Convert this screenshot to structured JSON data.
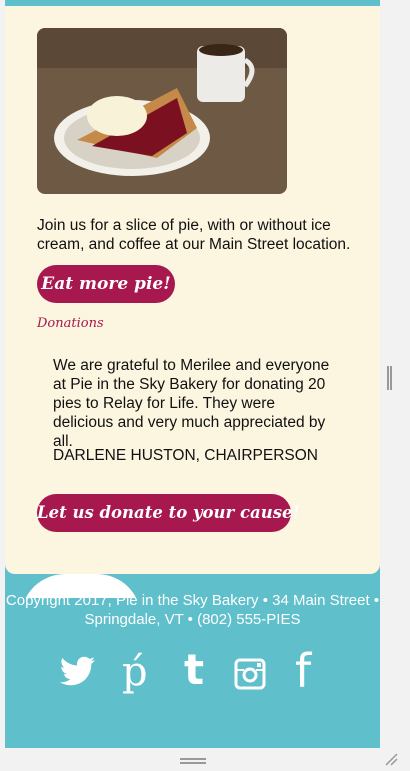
{
  "intro_text": "Join us for a slice of pie, with or without ice cream, and coffee at our Main Street location.",
  "eat_button": "Eat more pie!",
  "donations_heading": "Donations",
  "quote_text": "We are grateful to Merilee and everyone at Pie in the Sky Bakery for donating 20 pies to Relay for Life. They were delicious and very much appreciated by all.",
  "signature": "DARLENE HUSTON, CHAIRPERSON",
  "donate_button": "Let us donate to your cause!",
  "footer": "Copyright 2017, Pie in the Sky Bakery • 34 Main Street • Springdale, VT • (802) 555-PIES",
  "social_icons": [
    "twitter-icon",
    "pinterest-icon",
    "tumblr-icon",
    "instagram-icon",
    "facebook-icon"
  ],
  "colors": {
    "accent": "#a7184f",
    "card": "#fcf5df",
    "footer_bg": "#5fbfcb"
  }
}
